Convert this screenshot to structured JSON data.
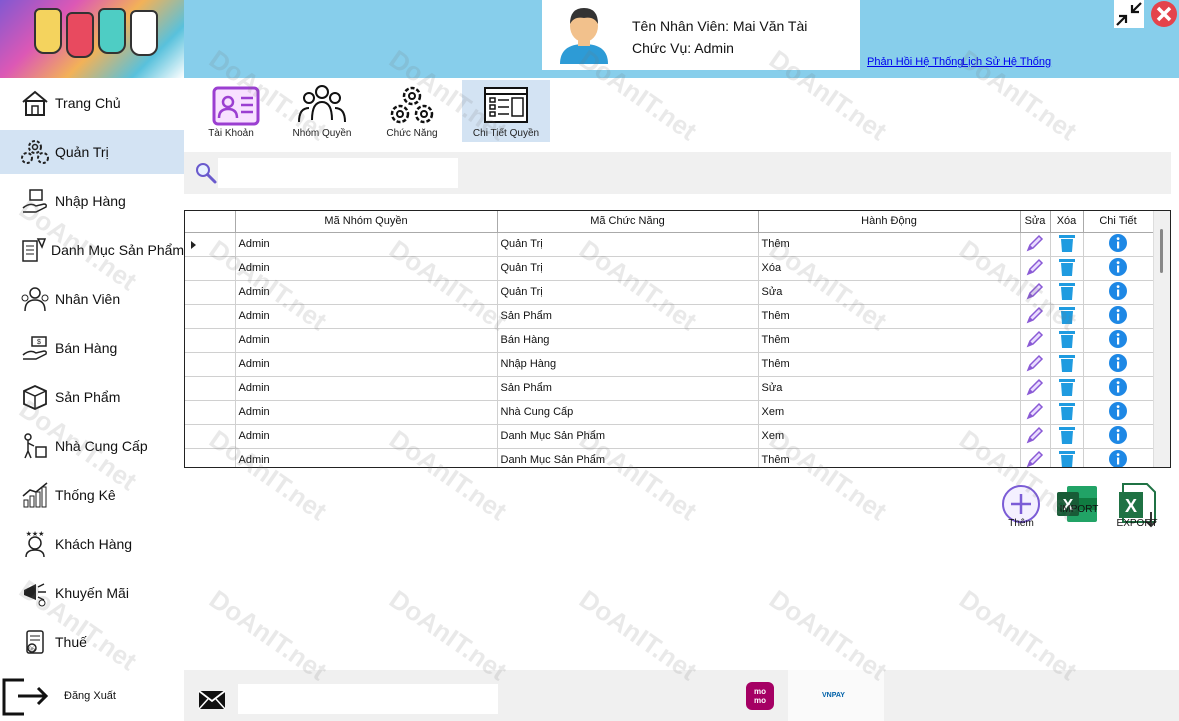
{
  "header": {
    "employee_name": "Tên Nhân Viên: Mai Văn Tài",
    "role": "Chức Vụ: Admin",
    "feedback_link": "Phản Hồi Hệ Thống",
    "history_link": "Lịch Sử Hệ Thống",
    "background_color": "#87ceeb"
  },
  "sidebar": {
    "items": [
      {
        "label": "Trang Chủ",
        "icon": "home-icon"
      },
      {
        "label": "Quản Trị",
        "icon": "admin-gears-icon",
        "active": true
      },
      {
        "label": "Nhập Hàng",
        "icon": "import-goods-icon"
      },
      {
        "label": "Danh Mục Sản Phẩm",
        "icon": "category-icon"
      },
      {
        "label": "Nhân Viên",
        "icon": "employee-icon"
      },
      {
        "label": "Bán Hàng",
        "icon": "sales-icon"
      },
      {
        "label": "Sản Phẩm",
        "icon": "product-box-icon"
      },
      {
        "label": "Nhà Cung Cấp",
        "icon": "supplier-icon"
      },
      {
        "label": "Thống Kê",
        "icon": "statistics-icon"
      },
      {
        "label": "Khách Hàng",
        "icon": "customer-icon"
      },
      {
        "label": "Khuyến Mãi",
        "icon": "promotion-icon"
      },
      {
        "label": "Thuế",
        "icon": "tax-icon"
      }
    ],
    "logout_label": "Đăng Xuất",
    "active_color": "#d3e3f3"
  },
  "subtabs": [
    {
      "label": "Tài Khoản",
      "icon": "account-card-icon"
    },
    {
      "label": "Nhóm Quyền",
      "icon": "user-group-icon"
    },
    {
      "label": "Chức Năng",
      "icon": "function-gears-icon"
    },
    {
      "label": "Chi Tiết Quyền",
      "icon": "permission-detail-icon",
      "active": true
    }
  ],
  "search": {
    "value": "",
    "placeholder": ""
  },
  "table": {
    "columns": [
      "Mã Nhóm Quyền",
      "Mã Chức Năng",
      "Hành Động",
      "Sửa",
      "Xóa",
      "Chi Tiết"
    ],
    "rows": [
      [
        "Admin",
        "Quản Trị",
        "Thêm"
      ],
      [
        "Admin",
        "Quản Trị",
        "Xóa"
      ],
      [
        "Admin",
        "Quản Trị",
        "Sửa"
      ],
      [
        "Admin",
        "Sản Phẩm",
        "Thêm"
      ],
      [
        "Admin",
        "Bán Hàng",
        "Thêm"
      ],
      [
        "Admin",
        "Nhập Hàng",
        "Thêm"
      ],
      [
        "Admin",
        "Sản Phẩm",
        "Sửa"
      ],
      [
        "Admin",
        "Nhà Cung Cấp",
        "Xem"
      ],
      [
        "Admin",
        "Danh Mục Sản Phẩm",
        "Xem"
      ],
      [
        "Admin",
        "Danh Mục Sản Phẩm",
        "Thêm"
      ]
    ]
  },
  "actions": {
    "add_label": "Thêm",
    "import_label": "IMPORT",
    "export_label": "EXPORT"
  },
  "footer": {
    "message_value": "",
    "momo_label": "mo mo",
    "vnpay_label": "VNPAY"
  },
  "watermark": "DoAnIT.net"
}
